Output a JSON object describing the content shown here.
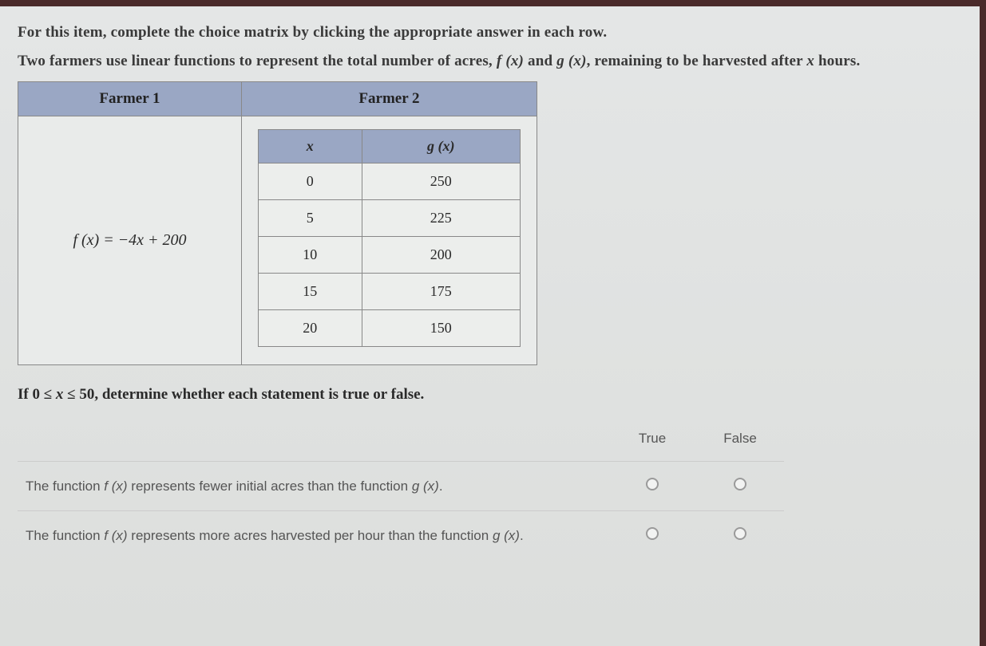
{
  "intro1": "For this item, complete the choice matrix by clicking the appropriate answer in each row.",
  "intro2_a": "Two farmers use linear functions to represent the total number of acres, ",
  "intro2_f": "f (x)",
  "intro2_b": " and ",
  "intro2_g": "g (x)",
  "intro2_c": ", remaining to be harvested after ",
  "intro2_x": "x",
  "intro2_d": " hours.",
  "table": {
    "head1": "Farmer 1",
    "head2": "Farmer 2",
    "f_formula": "f (x) = −4x + 200",
    "inner_head_x": "x",
    "inner_head_g": "g (x)",
    "rows": [
      {
        "x": "0",
        "g": "250"
      },
      {
        "x": "5",
        "g": "225"
      },
      {
        "x": "10",
        "g": "200"
      },
      {
        "x": "15",
        "g": "175"
      },
      {
        "x": "20",
        "g": "150"
      }
    ]
  },
  "mid_a": "If 0 ≤ ",
  "mid_x": "x",
  "mid_b": " ≤ 50, determine whether each statement is true or false.",
  "matrix": {
    "true_label": "True",
    "false_label": "False",
    "statements": [
      {
        "a": "The function ",
        "f": "f (x)",
        "b": " represents fewer initial acres than the function ",
        "g": "g (x)",
        "c": "."
      },
      {
        "a": "The function ",
        "f": "f (x)",
        "b": " represents more acres harvested per hour than the function ",
        "g": "g (x)",
        "c": "."
      }
    ]
  }
}
